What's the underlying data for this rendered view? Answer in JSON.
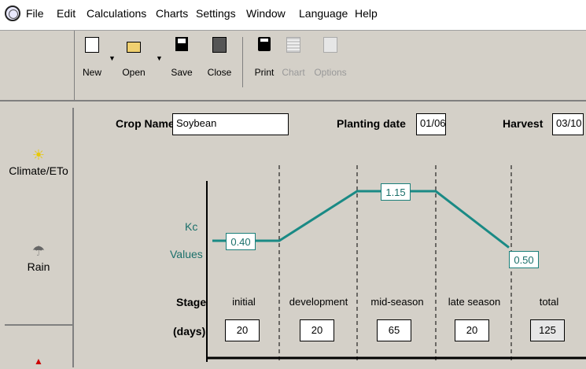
{
  "menu": {
    "items": [
      "File",
      "Edit",
      "Calculations",
      "Charts",
      "Settings",
      "Window",
      "Language",
      "Help"
    ]
  },
  "toolbar": {
    "new_label": "New",
    "open_label": "Open",
    "save_label": "Save",
    "close_label": "Close",
    "print_label": "Print",
    "chart_label": "Chart",
    "options_label": "Options",
    "dropdown_arrow": "▼"
  },
  "sidebar": {
    "climate_label": "Climate/ETo",
    "climate_icon": "sun-icon",
    "rain_label": "Rain",
    "rain_icon": "rain-cloud-icon"
  },
  "form": {
    "crop_name_label": "Crop Name",
    "crop_name_value": "Soybean",
    "planting_date_label": "Planting date",
    "planting_date_value": "01/06",
    "harvest_label": "Harvest",
    "harvest_value": "03/10"
  },
  "kc": {
    "label_line1": "Kc",
    "label_line2": "Values",
    "initial": "0.40",
    "mid": "1.15",
    "end": "0.50",
    "initial_value": 0.4,
    "mid_value": 1.15,
    "end_value": 0.5,
    "line_color": "#1a8a85"
  },
  "stages": {
    "stage_label": "Stage",
    "days_label": "(days)",
    "names": [
      "initial",
      "development",
      "mid-season",
      "late season",
      "total"
    ],
    "days": [
      "20",
      "20",
      "65",
      "20",
      "125"
    ]
  }
}
